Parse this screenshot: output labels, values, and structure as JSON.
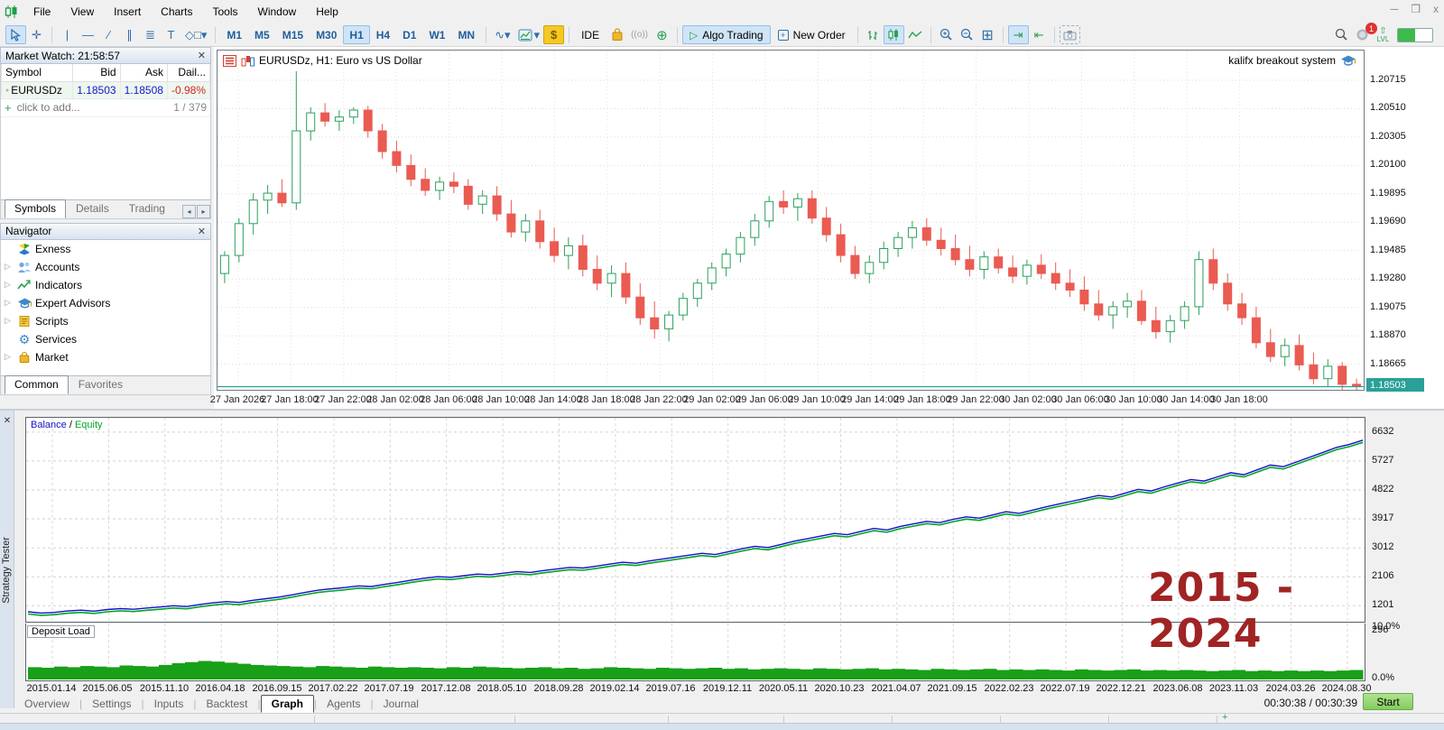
{
  "menu": {
    "items": [
      "File",
      "View",
      "Insert",
      "Charts",
      "Tools",
      "Window",
      "Help"
    ]
  },
  "toolbar": {
    "timeframes": [
      "M1",
      "M5",
      "M15",
      "M30",
      "H1",
      "H4",
      "D1",
      "W1",
      "MN"
    ],
    "active_timeframe": "H1",
    "buttons": {
      "algo_trading": "Algo Trading",
      "new_order": "New Order",
      "ide": "IDE",
      "dollar": "$",
      "lvl": "LVL"
    },
    "notification_badge": "1"
  },
  "market_watch": {
    "title": "Market Watch: 21:58:57",
    "columns": [
      "Symbol",
      "Bid",
      "Ask",
      "Dail..."
    ],
    "rows": [
      {
        "symbol": "EURUSDz",
        "bid": "1.18503",
        "ask": "1.18508",
        "daily": "-0.98%"
      }
    ],
    "add_label": "click to add...",
    "counter": "1 / 379",
    "tabs": [
      "Symbols",
      "Details",
      "Trading"
    ],
    "active_tab": "Symbols"
  },
  "navigator": {
    "title": "Navigator",
    "root": "Exness",
    "items": [
      {
        "label": "Accounts",
        "icon": "users-icon",
        "expandable": true
      },
      {
        "label": "Indicators",
        "icon": "indicator-icon",
        "expandable": true
      },
      {
        "label": "Expert Advisors",
        "icon": "graduation-cap-icon",
        "expandable": true
      },
      {
        "label": "Scripts",
        "icon": "script-icon",
        "expandable": true
      },
      {
        "label": "Services",
        "icon": "gear-icon",
        "expandable": false
      },
      {
        "label": "Market",
        "icon": "bag-icon",
        "expandable": true
      }
    ],
    "tabs": [
      "Common",
      "Favorites"
    ],
    "active_tab": "Common"
  },
  "chart": {
    "header": "EURUSDz, H1:  Euro vs US Dollar",
    "ea_label": "kalifx breakout system",
    "current_price": "1.18503",
    "price_max": 1.2093,
    "price_min": 1.1848,
    "y_ticks": [
      "1.20715",
      "1.20510",
      "1.20305",
      "1.20100",
      "1.19895",
      "1.19690",
      "1.19485",
      "1.19280",
      "1.19075",
      "1.18870",
      "1.18665"
    ],
    "x_labels": [
      "27 Jan 2026",
      "27 Jan 18:00",
      "27 Jan 22:00",
      "28 Jan 02:00",
      "28 Jan 06:00",
      "28 Jan 10:00",
      "28 Jan 14:00",
      "28 Jan 18:00",
      "28 Jan 22:00",
      "29 Jan 02:00",
      "29 Jan 06:00",
      "29 Jan 10:00",
      "29 Jan 14:00",
      "29 Jan 18:00",
      "29 Jan 22:00",
      "30 Jan 02:00",
      "30 Jan 06:00",
      "30 Jan 10:00",
      "30 Jan 14:00",
      "30 Jan 18:00"
    ],
    "colors": {
      "up": "#2aa05a",
      "down": "#ea5b52",
      "price_line": "#2aa098"
    },
    "candles": [
      [
        1.1932,
        1.1948,
        1.1925,
        1.1945
      ],
      [
        1.1945,
        1.1972,
        1.194,
        1.1968
      ],
      [
        1.1968,
        1.199,
        1.196,
        1.1985
      ],
      [
        1.1985,
        1.1996,
        1.1975,
        1.199
      ],
      [
        1.199,
        1.2,
        1.198,
        1.1983
      ],
      [
        1.1983,
        1.2078,
        1.1978,
        1.2035
      ],
      [
        1.2035,
        1.2052,
        1.2028,
        1.2048
      ],
      [
        1.2048,
        1.2055,
        1.2038,
        1.2042
      ],
      [
        1.2042,
        1.205,
        1.2035,
        1.2045
      ],
      [
        1.2045,
        1.2052,
        1.204,
        1.205
      ],
      [
        1.205,
        1.2053,
        1.203,
        1.2035
      ],
      [
        1.2035,
        1.204,
        1.2015,
        1.202
      ],
      [
        1.202,
        1.2028,
        1.2005,
        1.201
      ],
      [
        1.201,
        1.2018,
        1.1995,
        1.2
      ],
      [
        1.2,
        1.2008,
        1.1988,
        1.1992
      ],
      [
        1.1992,
        1.2002,
        1.1985,
        1.1998
      ],
      [
        1.1998,
        1.2005,
        1.199,
        1.1995
      ],
      [
        1.1995,
        1.2,
        1.1978,
        1.1982
      ],
      [
        1.1982,
        1.1992,
        1.1975,
        1.1988
      ],
      [
        1.1988,
        1.1995,
        1.197,
        1.1975
      ],
      [
        1.1975,
        1.1985,
        1.1958,
        1.1962
      ],
      [
        1.1962,
        1.1975,
        1.1955,
        1.197
      ],
      [
        1.197,
        1.1978,
        1.195,
        1.1955
      ],
      [
        1.1955,
        1.1965,
        1.194,
        1.1945
      ],
      [
        1.1945,
        1.1958,
        1.1935,
        1.1952
      ],
      [
        1.1952,
        1.196,
        1.193,
        1.1935
      ],
      [
        1.1935,
        1.1945,
        1.192,
        1.1925
      ],
      [
        1.1925,
        1.1938,
        1.1915,
        1.1932
      ],
      [
        1.1932,
        1.194,
        1.191,
        1.1915
      ],
      [
        1.1915,
        1.1925,
        1.1895,
        1.19
      ],
      [
        1.19,
        1.1912,
        1.1885,
        1.1892
      ],
      [
        1.1892,
        1.1905,
        1.1883,
        1.1902
      ],
      [
        1.1902,
        1.1918,
        1.1898,
        1.1914
      ],
      [
        1.1914,
        1.1928,
        1.1908,
        1.1925
      ],
      [
        1.1925,
        1.194,
        1.192,
        1.1936
      ],
      [
        1.1936,
        1.195,
        1.193,
        1.1946
      ],
      [
        1.1946,
        1.1962,
        1.194,
        1.1958
      ],
      [
        1.1958,
        1.1975,
        1.1952,
        1.197
      ],
      [
        1.197,
        1.1988,
        1.1965,
        1.1984
      ],
      [
        1.1984,
        1.1992,
        1.1975,
        1.198
      ],
      [
        1.198,
        1.199,
        1.197,
        1.1986
      ],
      [
        1.1986,
        1.1992,
        1.1968,
        1.1972
      ],
      [
        1.1972,
        1.198,
        1.1955,
        1.196
      ],
      [
        1.196,
        1.1968,
        1.194,
        1.1945
      ],
      [
        1.1945,
        1.1952,
        1.1928,
        1.1932
      ],
      [
        1.1932,
        1.1945,
        1.1925,
        1.194
      ],
      [
        1.194,
        1.1955,
        1.1935,
        1.195
      ],
      [
        1.195,
        1.1962,
        1.1944,
        1.1958
      ],
      [
        1.1958,
        1.197,
        1.195,
        1.1965
      ],
      [
        1.1965,
        1.1972,
        1.1952,
        1.1956
      ],
      [
        1.1956,
        1.1965,
        1.1945,
        1.195
      ],
      [
        1.195,
        1.196,
        1.1938,
        1.1942
      ],
      [
        1.1942,
        1.1952,
        1.193,
        1.1935
      ],
      [
        1.1935,
        1.1948,
        1.1928,
        1.1944
      ],
      [
        1.1944,
        1.195,
        1.1932,
        1.1936
      ],
      [
        1.1936,
        1.1945,
        1.1925,
        1.193
      ],
      [
        1.193,
        1.1942,
        1.1924,
        1.1938
      ],
      [
        1.1938,
        1.1946,
        1.1928,
        1.1932
      ],
      [
        1.1932,
        1.194,
        1.192,
        1.1925
      ],
      [
        1.1925,
        1.1935,
        1.1915,
        1.192
      ],
      [
        1.192,
        1.193,
        1.1905,
        1.191
      ],
      [
        1.191,
        1.192,
        1.1898,
        1.1902
      ],
      [
        1.1902,
        1.1912,
        1.1892,
        1.1908
      ],
      [
        1.1908,
        1.1918,
        1.19,
        1.1912
      ],
      [
        1.1912,
        1.192,
        1.1895,
        1.1898
      ],
      [
        1.1898,
        1.1908,
        1.1885,
        1.189
      ],
      [
        1.189,
        1.1902,
        1.1882,
        1.1898
      ],
      [
        1.1898,
        1.1912,
        1.1892,
        1.1908
      ],
      [
        1.1908,
        1.1948,
        1.1902,
        1.1942
      ],
      [
        1.1942,
        1.195,
        1.192,
        1.1925
      ],
      [
        1.1925,
        1.1932,
        1.1905,
        1.191
      ],
      [
        1.191,
        1.1918,
        1.1895,
        1.19
      ],
      [
        1.19,
        1.1908,
        1.1878,
        1.1882
      ],
      [
        1.1882,
        1.1892,
        1.1868,
        1.1872
      ],
      [
        1.1872,
        1.1885,
        1.1865,
        1.188
      ],
      [
        1.188,
        1.1888,
        1.1862,
        1.1866
      ],
      [
        1.1866,
        1.1875,
        1.1852,
        1.1856
      ],
      [
        1.1856,
        1.187,
        1.185,
        1.1865
      ],
      [
        1.1865,
        1.1868,
        1.1848,
        1.1852
      ],
      [
        1.1852,
        1.1856,
        1.1846,
        1.18503
      ]
    ]
  },
  "tester": {
    "panel_label": "Strategy Tester",
    "legend_balance": "Balance",
    "legend_sep": " / ",
    "legend_equity": "Equity",
    "watermark": "2015 - 2024",
    "deposit_load_label": "Deposit Load",
    "balance_ticks": [
      6632,
      5727,
      4822,
      3917,
      3012,
      2106,
      1201,
      296
    ],
    "load_ticks": [
      "10.0%",
      "0.0%"
    ],
    "val_max": 7080,
    "val_min": 700,
    "load_max": 10,
    "colors": {
      "balance": "#1212cc",
      "equity": "#00a527",
      "load": "#18a018"
    },
    "dates": [
      "2015.01.14",
      "2015.06.05",
      "2015.11.10",
      "2016.04.18",
      "2016.09.15",
      "2017.02.22",
      "2017.07.19",
      "2017.12.08",
      "2018.05.10",
      "2018.09.28",
      "2019.02.14",
      "2019.07.16",
      "2019.12.11",
      "2020.05.11",
      "2020.10.23",
      "2021.04.07",
      "2021.09.15",
      "2022.02.23",
      "2022.07.19",
      "2022.12.21",
      "2023.06.08",
      "2023.11.03",
      "2024.03.26",
      "2024.08.30"
    ],
    "balance": [
      1010,
      970,
      990,
      1035,
      1060,
      1030,
      1080,
      1110,
      1090,
      1130,
      1160,
      1200,
      1175,
      1240,
      1290,
      1330,
      1305,
      1370,
      1420,
      1470,
      1540,
      1620,
      1690,
      1730,
      1770,
      1820,
      1800,
      1870,
      1930,
      2000,
      2060,
      2110,
      2090,
      2140,
      2190,
      2170,
      2220,
      2270,
      2240,
      2300,
      2350,
      2400,
      2380,
      2440,
      2500,
      2560,
      2530,
      2600,
      2660,
      2720,
      2780,
      2840,
      2800,
      2890,
      2980,
      3060,
      3020,
      3120,
      3220,
      3300,
      3380,
      3460,
      3420,
      3520,
      3620,
      3570,
      3680,
      3760,
      3840,
      3800,
      3900,
      3980,
      3940,
      4040,
      4140,
      4090,
      4190,
      4290,
      4380,
      4470,
      4560,
      4650,
      4600,
      4720,
      4840,
      4790,
      4920,
      5040,
      5150,
      5100,
      5230,
      5360,
      5300,
      5450,
      5600,
      5550,
      5700,
      5850,
      6000,
      6150,
      6250,
      6380
    ],
    "equity_tracks_balance": true,
    "deposit_load": [
      2.2,
      2.1,
      2.3,
      2.2,
      2.4,
      2.3,
      2.2,
      2.5,
      2.4,
      2.3,
      2.6,
      2.9,
      3.1,
      3.3,
      3.2,
      3.0,
      2.8,
      2.6,
      2.5,
      2.4,
      2.3,
      2.2,
      2.4,
      2.3,
      2.2,
      2.1,
      2.3,
      2.2,
      2.1,
      2.2,
      2.1,
      2.0,
      2.2,
      2.1,
      2.3,
      2.2,
      2.1,
      2.0,
      2.1,
      2.2,
      2.0,
      2.1,
      1.9,
      2.0,
      2.2,
      2.1,
      2.0,
      1.9,
      2.1,
      2.0,
      1.9,
      2.0,
      2.1,
      1.9,
      2.0,
      1.8,
      1.9,
      2.0,
      1.9,
      1.8,
      2.0,
      1.9,
      1.8,
      1.9,
      2.0,
      1.8,
      1.9,
      1.8,
      1.7,
      1.9,
      1.8,
      1.7,
      1.8,
      1.9,
      1.7,
      1.8,
      1.7,
      1.8,
      1.7,
      1.6,
      1.8,
      1.7,
      1.6,
      1.7,
      1.8,
      1.6,
      1.7,
      1.6,
      1.7,
      1.6,
      1.5,
      1.6,
      1.7,
      1.5,
      1.6,
      1.5,
      1.6,
      1.5,
      1.6,
      1.5,
      1.6,
      1.7
    ],
    "tabs": [
      "Overview",
      "Settings",
      "Inputs",
      "Backtest",
      "Graph",
      "Agents",
      "Journal"
    ],
    "active_tab": "Graph",
    "timer": "00:30:38 / 00:30:39",
    "start_label": "Start"
  }
}
